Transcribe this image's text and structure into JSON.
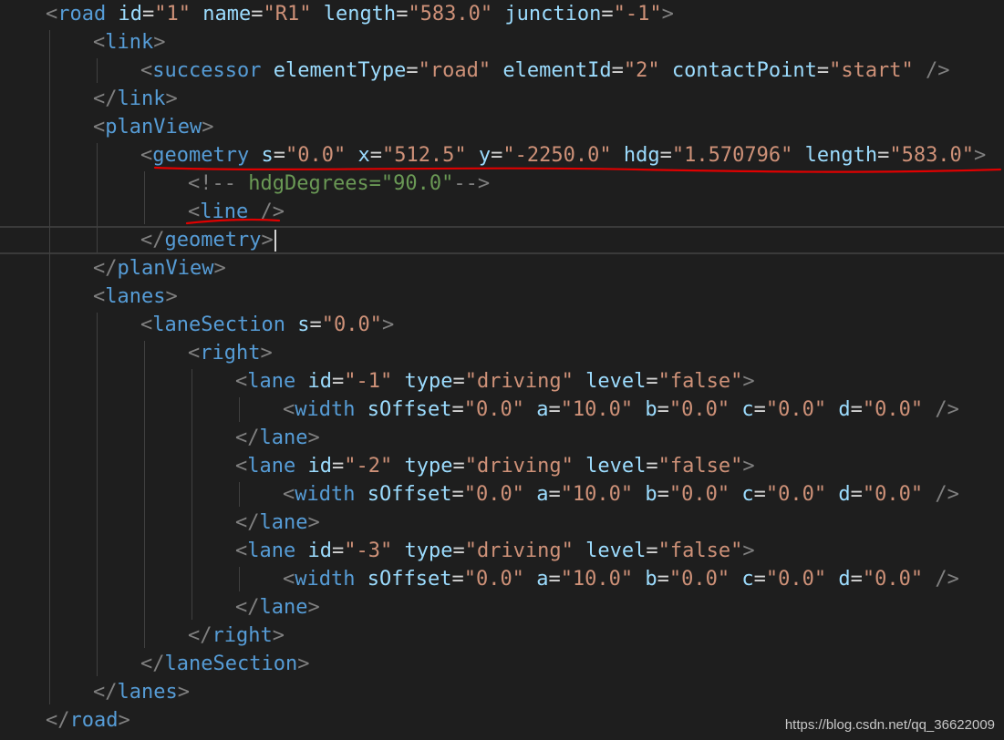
{
  "editor": {
    "lines": [
      {
        "indent": 1,
        "tokens": [
          [
            "p",
            "<"
          ],
          [
            "t",
            "road"
          ],
          [
            "s",
            " "
          ],
          [
            "a",
            "id"
          ],
          [
            "e",
            "="
          ],
          [
            "v",
            "\"1\""
          ],
          [
            "s",
            " "
          ],
          [
            "a",
            "name"
          ],
          [
            "e",
            "="
          ],
          [
            "v",
            "\"R1\""
          ],
          [
            "s",
            " "
          ],
          [
            "a",
            "length"
          ],
          [
            "e",
            "="
          ],
          [
            "v",
            "\"583.0\""
          ],
          [
            "s",
            " "
          ],
          [
            "a",
            "junction"
          ],
          [
            "e",
            "="
          ],
          [
            "v",
            "\"-1\""
          ],
          [
            "p",
            ">"
          ]
        ]
      },
      {
        "indent": 2,
        "tokens": [
          [
            "p",
            "<"
          ],
          [
            "t",
            "link"
          ],
          [
            "p",
            ">"
          ]
        ]
      },
      {
        "indent": 3,
        "tokens": [
          [
            "p",
            "<"
          ],
          [
            "t",
            "successor"
          ],
          [
            "s",
            " "
          ],
          [
            "a",
            "elementType"
          ],
          [
            "e",
            "="
          ],
          [
            "v",
            "\"road\""
          ],
          [
            "s",
            " "
          ],
          [
            "a",
            "elementId"
          ],
          [
            "e",
            "="
          ],
          [
            "v",
            "\"2\""
          ],
          [
            "s",
            " "
          ],
          [
            "a",
            "contactPoint"
          ],
          [
            "e",
            "="
          ],
          [
            "v",
            "\"start\""
          ],
          [
            "s",
            " "
          ],
          [
            "p",
            "/>"
          ]
        ]
      },
      {
        "indent": 2,
        "tokens": [
          [
            "p",
            "</"
          ],
          [
            "t",
            "link"
          ],
          [
            "p",
            ">"
          ]
        ]
      },
      {
        "indent": 2,
        "tokens": [
          [
            "p",
            "<"
          ],
          [
            "t",
            "planView"
          ],
          [
            "p",
            ">"
          ]
        ]
      },
      {
        "indent": 3,
        "tokens": [
          [
            "p",
            "<"
          ],
          [
            "t",
            "geometry"
          ],
          [
            "s",
            " "
          ],
          [
            "a",
            "s"
          ],
          [
            "e",
            "="
          ],
          [
            "v",
            "\"0.0\""
          ],
          [
            "s",
            " "
          ],
          [
            "a",
            "x"
          ],
          [
            "e",
            "="
          ],
          [
            "v",
            "\"512.5\""
          ],
          [
            "s",
            " "
          ],
          [
            "a",
            "y"
          ],
          [
            "e",
            "="
          ],
          [
            "v",
            "\"-2250.0\""
          ],
          [
            "s",
            " "
          ],
          [
            "a",
            "hdg"
          ],
          [
            "e",
            "="
          ],
          [
            "v",
            "\"1.570796\""
          ],
          [
            "s",
            " "
          ],
          [
            "a",
            "length"
          ],
          [
            "e",
            "="
          ],
          [
            "v",
            "\"583.0\""
          ],
          [
            "p",
            ">"
          ]
        ]
      },
      {
        "indent": 4,
        "tokens": [
          [
            "p",
            "<!--"
          ],
          [
            "c",
            " hdgDegrees=\"90.0\""
          ],
          [
            "p",
            "-->"
          ]
        ]
      },
      {
        "indent": 4,
        "tokens": [
          [
            "p",
            "<"
          ],
          [
            "t",
            "line"
          ],
          [
            "s",
            " "
          ],
          [
            "p",
            "/>"
          ]
        ]
      },
      {
        "indent": 3,
        "tokens": [
          [
            "p",
            "</"
          ],
          [
            "t",
            "geometry"
          ],
          [
            "p",
            ">"
          ]
        ],
        "cursor": true
      },
      {
        "indent": 2,
        "tokens": [
          [
            "p",
            "</"
          ],
          [
            "t",
            "planView"
          ],
          [
            "p",
            ">"
          ]
        ]
      },
      {
        "indent": 2,
        "tokens": [
          [
            "p",
            "<"
          ],
          [
            "t",
            "lanes"
          ],
          [
            "p",
            ">"
          ]
        ]
      },
      {
        "indent": 3,
        "tokens": [
          [
            "p",
            "<"
          ],
          [
            "t",
            "laneSection"
          ],
          [
            "s",
            " "
          ],
          [
            "a",
            "s"
          ],
          [
            "e",
            "="
          ],
          [
            "v",
            "\"0.0\""
          ],
          [
            "p",
            ">"
          ]
        ]
      },
      {
        "indent": 4,
        "tokens": [
          [
            "p",
            "<"
          ],
          [
            "t",
            "right"
          ],
          [
            "p",
            ">"
          ]
        ]
      },
      {
        "indent": 5,
        "tokens": [
          [
            "p",
            "<"
          ],
          [
            "t",
            "lane"
          ],
          [
            "s",
            " "
          ],
          [
            "a",
            "id"
          ],
          [
            "e",
            "="
          ],
          [
            "v",
            "\"-1\""
          ],
          [
            "s",
            " "
          ],
          [
            "a",
            "type"
          ],
          [
            "e",
            "="
          ],
          [
            "v",
            "\"driving\""
          ],
          [
            "s",
            " "
          ],
          [
            "a",
            "level"
          ],
          [
            "e",
            "="
          ],
          [
            "v",
            "\"false\""
          ],
          [
            "p",
            ">"
          ]
        ]
      },
      {
        "indent": 6,
        "tokens": [
          [
            "p",
            "<"
          ],
          [
            "t",
            "width"
          ],
          [
            "s",
            " "
          ],
          [
            "a",
            "sOffset"
          ],
          [
            "e",
            "="
          ],
          [
            "v",
            "\"0.0\""
          ],
          [
            "s",
            " "
          ],
          [
            "a",
            "a"
          ],
          [
            "e",
            "="
          ],
          [
            "v",
            "\"10.0\""
          ],
          [
            "s",
            " "
          ],
          [
            "a",
            "b"
          ],
          [
            "e",
            "="
          ],
          [
            "v",
            "\"0.0\""
          ],
          [
            "s",
            " "
          ],
          [
            "a",
            "c"
          ],
          [
            "e",
            "="
          ],
          [
            "v",
            "\"0.0\""
          ],
          [
            "s",
            " "
          ],
          [
            "a",
            "d"
          ],
          [
            "e",
            "="
          ],
          [
            "v",
            "\"0.0\""
          ],
          [
            "s",
            " "
          ],
          [
            "p",
            "/>"
          ]
        ]
      },
      {
        "indent": 5,
        "tokens": [
          [
            "p",
            "</"
          ],
          [
            "t",
            "lane"
          ],
          [
            "p",
            ">"
          ]
        ]
      },
      {
        "indent": 5,
        "tokens": [
          [
            "p",
            "<"
          ],
          [
            "t",
            "lane"
          ],
          [
            "s",
            " "
          ],
          [
            "a",
            "id"
          ],
          [
            "e",
            "="
          ],
          [
            "v",
            "\"-2\""
          ],
          [
            "s",
            " "
          ],
          [
            "a",
            "type"
          ],
          [
            "e",
            "="
          ],
          [
            "v",
            "\"driving\""
          ],
          [
            "s",
            " "
          ],
          [
            "a",
            "level"
          ],
          [
            "e",
            "="
          ],
          [
            "v",
            "\"false\""
          ],
          [
            "p",
            ">"
          ]
        ]
      },
      {
        "indent": 6,
        "tokens": [
          [
            "p",
            "<"
          ],
          [
            "t",
            "width"
          ],
          [
            "s",
            " "
          ],
          [
            "a",
            "sOffset"
          ],
          [
            "e",
            "="
          ],
          [
            "v",
            "\"0.0\""
          ],
          [
            "s",
            " "
          ],
          [
            "a",
            "a"
          ],
          [
            "e",
            "="
          ],
          [
            "v",
            "\"10.0\""
          ],
          [
            "s",
            " "
          ],
          [
            "a",
            "b"
          ],
          [
            "e",
            "="
          ],
          [
            "v",
            "\"0.0\""
          ],
          [
            "s",
            " "
          ],
          [
            "a",
            "c"
          ],
          [
            "e",
            "="
          ],
          [
            "v",
            "\"0.0\""
          ],
          [
            "s",
            " "
          ],
          [
            "a",
            "d"
          ],
          [
            "e",
            "="
          ],
          [
            "v",
            "\"0.0\""
          ],
          [
            "s",
            " "
          ],
          [
            "p",
            "/>"
          ]
        ]
      },
      {
        "indent": 5,
        "tokens": [
          [
            "p",
            "</"
          ],
          [
            "t",
            "lane"
          ],
          [
            "p",
            ">"
          ]
        ]
      },
      {
        "indent": 5,
        "tokens": [
          [
            "p",
            "<"
          ],
          [
            "t",
            "lane"
          ],
          [
            "s",
            " "
          ],
          [
            "a",
            "id"
          ],
          [
            "e",
            "="
          ],
          [
            "v",
            "\"-3\""
          ],
          [
            "s",
            " "
          ],
          [
            "a",
            "type"
          ],
          [
            "e",
            "="
          ],
          [
            "v",
            "\"driving\""
          ],
          [
            "s",
            " "
          ],
          [
            "a",
            "level"
          ],
          [
            "e",
            "="
          ],
          [
            "v",
            "\"false\""
          ],
          [
            "p",
            ">"
          ]
        ]
      },
      {
        "indent": 6,
        "tokens": [
          [
            "p",
            "<"
          ],
          [
            "t",
            "width"
          ],
          [
            "s",
            " "
          ],
          [
            "a",
            "sOffset"
          ],
          [
            "e",
            "="
          ],
          [
            "v",
            "\"0.0\""
          ],
          [
            "s",
            " "
          ],
          [
            "a",
            "a"
          ],
          [
            "e",
            "="
          ],
          [
            "v",
            "\"10.0\""
          ],
          [
            "s",
            " "
          ],
          [
            "a",
            "b"
          ],
          [
            "e",
            "="
          ],
          [
            "v",
            "\"0.0\""
          ],
          [
            "s",
            " "
          ],
          [
            "a",
            "c"
          ],
          [
            "e",
            "="
          ],
          [
            "v",
            "\"0.0\""
          ],
          [
            "s",
            " "
          ],
          [
            "a",
            "d"
          ],
          [
            "e",
            "="
          ],
          [
            "v",
            "\"0.0\""
          ],
          [
            "s",
            " "
          ],
          [
            "p",
            "/>"
          ]
        ]
      },
      {
        "indent": 5,
        "tokens": [
          [
            "p",
            "</"
          ],
          [
            "t",
            "lane"
          ],
          [
            "p",
            ">"
          ]
        ]
      },
      {
        "indent": 4,
        "tokens": [
          [
            "p",
            "</"
          ],
          [
            "t",
            "right"
          ],
          [
            "p",
            ">"
          ]
        ]
      },
      {
        "indent": 3,
        "tokens": [
          [
            "p",
            "</"
          ],
          [
            "t",
            "laneSection"
          ],
          [
            "p",
            ">"
          ]
        ]
      },
      {
        "indent": 2,
        "tokens": [
          [
            "p",
            "</"
          ],
          [
            "t",
            "lanes"
          ],
          [
            "p",
            ">"
          ]
        ]
      },
      {
        "indent": 1,
        "tokens": [
          [
            "p",
            "</"
          ],
          [
            "t",
            "road"
          ],
          [
            "p",
            ">"
          ]
        ]
      }
    ]
  },
  "annotation_color": "#e00000",
  "watermark": "https://blog.csdn.net/qq_36622009"
}
